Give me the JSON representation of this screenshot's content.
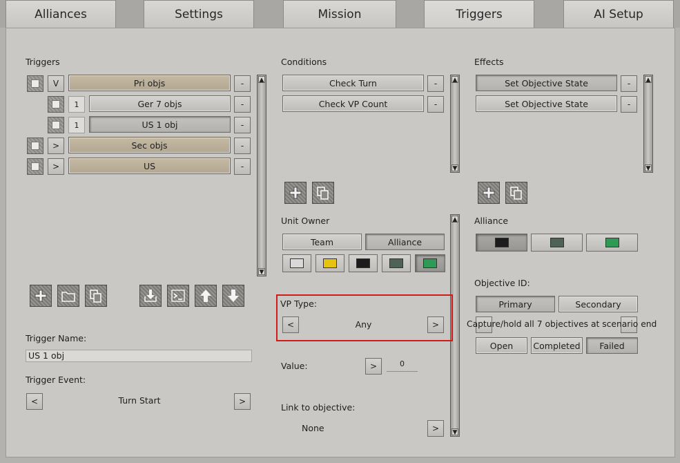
{
  "tabs": [
    "Alliances",
    "Settings",
    "Mission",
    "Triggers",
    "AI Setup"
  ],
  "triggers": {
    "title": "Triggers",
    "rows": [
      {
        "toggle": "V",
        "label": "Pri objs",
        "style": "tan"
      },
      {
        "num": "1",
        "label": "Ger 7 objs",
        "style": "grey"
      },
      {
        "num": "1",
        "label": "US 1 obj",
        "style": "sel"
      },
      {
        "toggle": ">",
        "label": "Sec objs",
        "style": "tan"
      },
      {
        "toggle": ">",
        "label": "US",
        "style": "tan"
      }
    ],
    "remove_label": "-",
    "name_label": "Trigger Name:",
    "name_value": "US 1 obj",
    "event_label": "Trigger Event:",
    "event_value": "Turn Start",
    "prev": "<",
    "next": ">"
  },
  "conditions": {
    "title": "Conditions",
    "items": [
      "Check Turn",
      "Check VP Count"
    ],
    "remove_label": "-",
    "unit_owner_label": "Unit Owner",
    "owner_tabs": [
      "Team",
      "Alliance"
    ],
    "colors": [
      "#d9d9d9",
      "#e6c30e",
      "#1c1c1c",
      "#4f6258",
      "#2e9a56"
    ],
    "vp_type_label": "VP Type:",
    "vp_type_value": "Any",
    "value_label": "Value:",
    "value": "0",
    "link_label": "Link to objective:",
    "link_value": "None",
    "prev": "<",
    "next": ">"
  },
  "effects": {
    "title": "Effects",
    "items": [
      "Set Objective State",
      "Set Objective State"
    ],
    "remove_label": "-",
    "alliance_label": "Alliance",
    "alliance_colors": [
      "#1c1c1c",
      "#4f6258",
      "#2e9a56"
    ],
    "objective_id_label": "Objective ID:",
    "objective_tabs": [
      "Primary",
      "Secondary"
    ],
    "objective_text": "Capture/hold all 7 objectives at scenario end",
    "states": [
      "Open",
      "Completed",
      "Failed"
    ]
  }
}
